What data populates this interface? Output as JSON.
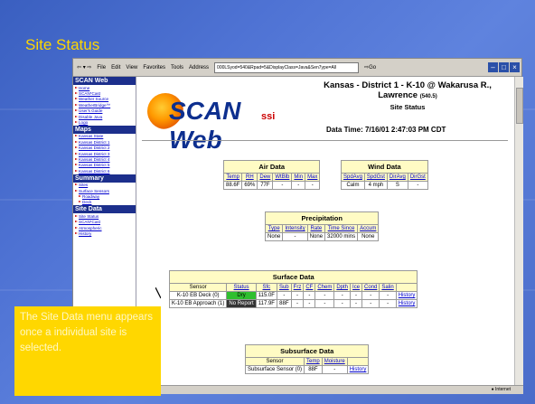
{
  "slide": {
    "title": "Site Status",
    "callout": "The Site Data menu appears once a individual site is selected."
  },
  "browser": {
    "menu": [
      "File",
      "Edit",
      "View",
      "Favorites",
      "Tools"
    ],
    "address_label": "Address",
    "address_value": "000LSyod=540&Rpad=5&DisplayClass=Java&Sen7ype=All",
    "go_label": "Go",
    "status_text": "Internet"
  },
  "sidebar": {
    "sections": [
      {
        "title": "SCAN Web",
        "items": [
          "Home",
          "SCAN*Cast",
          "Weather Source",
          "WeatherBridge™",
          "User's Guide",
          "Disable Java",
          "Logo"
        ]
      },
      {
        "title": "Maps",
        "items": [
          "Kansas State",
          "Kansas District 1",
          "Kansas District 2",
          "Kansas District 3",
          "Kansas District 4",
          "Kansas District 5",
          "Kansas District 6"
        ]
      },
      {
        "title": "Summary",
        "items": [
          "Sites",
          "Surface Sensors",
          "Roadway",
          "Deck"
        ]
      },
      {
        "title": "Site Data",
        "items": [
          "Site Status",
          "SCAN*Cast",
          "Atmospheric",
          "History"
        ]
      }
    ]
  },
  "header": {
    "logo_text": "SCAN Web",
    "logo_suffix": "ssi",
    "site_name_1": "Kansas - District 1 - K-10 @ Wakarusa R.,",
    "site_name_2": "Lawrence",
    "site_code": "(540.5)",
    "site_status": "Site Status",
    "data_time": "Data Time: 7/16/01 2:47:03 PM CDT"
  },
  "air_data": {
    "caption": "Air Data",
    "headers": [
      "Temp",
      "RH",
      "Dew",
      "WtBlb",
      "Min",
      "Max"
    ],
    "values": [
      "88.6F",
      "69%",
      "77F",
      "-",
      "-",
      "-"
    ]
  },
  "wind_data": {
    "caption": "Wind Data",
    "headers": [
      "SpdAvg",
      "SpdGst",
      "DirAvg",
      "DirGst"
    ],
    "values": [
      "Calm",
      "4 mph",
      "S",
      "-"
    ]
  },
  "precipitation": {
    "caption": "Precipitation",
    "headers": [
      "Type",
      "Intensity",
      "Rate",
      "Time Since",
      "Accum"
    ],
    "values": [
      "None",
      "-",
      "None",
      "32000 mins",
      "None"
    ]
  },
  "surface_data": {
    "caption": "Surface Data",
    "headers": [
      "Sensor",
      "Status",
      "Sfc",
      "Sub",
      "Frz",
      "CF",
      "Chem",
      "Dpth",
      "Ice",
      "Cond",
      "Salin",
      ""
    ],
    "rows": [
      [
        "K-10 EB Deck (0)",
        "Dry",
        "115.0F",
        "-",
        "-",
        "-",
        "-",
        "-",
        "-",
        "-",
        "-",
        "History"
      ],
      [
        "K-10 EB Approach (1)",
        "No Report",
        "117.9F",
        "88F",
        "-",
        "-",
        "-",
        "-",
        "-",
        "-",
        "-",
        "History"
      ]
    ]
  },
  "subsurface_data": {
    "caption": "Subsurface Data",
    "headers": [
      "Sensor",
      "Temp",
      "Moisture",
      ""
    ],
    "rows": [
      [
        "Subsurface Sensor (0)",
        "88F",
        "-",
        "History"
      ]
    ]
  }
}
